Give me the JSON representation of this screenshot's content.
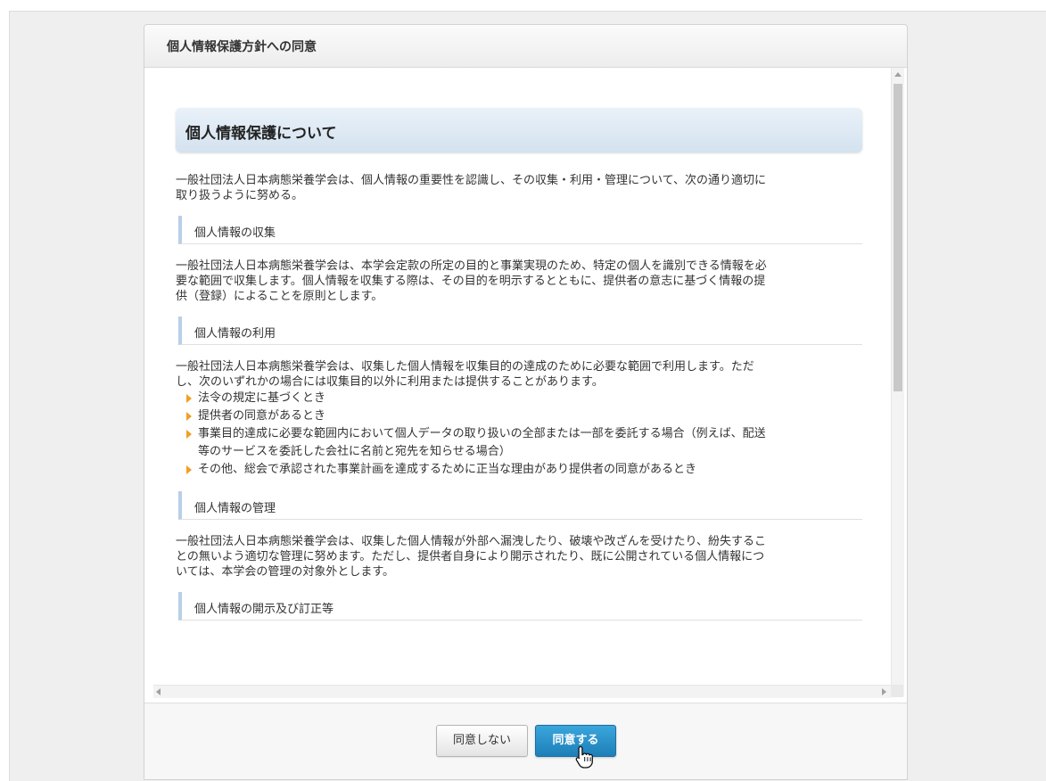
{
  "dialog": {
    "title": "個人情報保護方針への同意"
  },
  "policy": {
    "heading": "個人情報保護について",
    "intro": "一般社団法人日本病態栄養学会は、個人情報の重要性を認識し、その収集・利用・管理について、次の通り適切に\n取り扱うように努める。",
    "sections": [
      {
        "title": "個人情報の収集",
        "body": "一般社団法人日本病態栄養学会は、本学会定款の所定の目的と事業実現のため、特定の個人を識別できる情報を必\n要な範囲で収集します。個人情報を収集する際は、その目的を明示するとともに、提供者の意志に基づく情報の提\n供（登録）によることを原則とします。"
      },
      {
        "title": "個人情報の利用",
        "body": "一般社団法人日本病態栄養学会は、収集した個人情報を収集目的の達成のために必要な範囲で利用します。ただ\nし、次のいずれかの場合には収集目的以外に利用または提供することがあります。",
        "items": [
          "法令の規定に基づくとき",
          "提供者の同意があるとき",
          "事業目的達成に必要な範囲内において個人データの取り扱いの全部または一部を委託する場合（例えば、配送\n等のサービスを委託した会社に名前と宛先を知らせる場合）",
          "その他、総会で承認された事業計画を達成するために正当な理由があり提供者の同意があるとき"
        ]
      },
      {
        "title": "個人情報の管理",
        "body": "一般社団法人日本病態栄養学会は、収集した個人情報が外部へ漏洩したり、破壊や改ざんを受けたり、紛失するこ\nとの無いよう適切な管理に努めます。ただし、提供者自身により開示されたり、既に公開されている個人情報につ\nいては、本学会の管理の対象外とします。"
      },
      {
        "title": "個人情報の開示及び訂正等"
      }
    ]
  },
  "buttons": {
    "decline_label": "同意しない",
    "agree_label": "同意する"
  },
  "colors": {
    "accent": "#2a8ec8",
    "bullet": "#f0a020",
    "subheading_bar": "#b9cfe6"
  },
  "icons": [
    "hand-cursor-icon",
    "bullet-arrow-icon",
    "scroll-up-arrow-icon",
    "scroll-down-arrow-icon",
    "scroll-left-arrow-icon",
    "scroll-right-arrow-icon"
  ]
}
